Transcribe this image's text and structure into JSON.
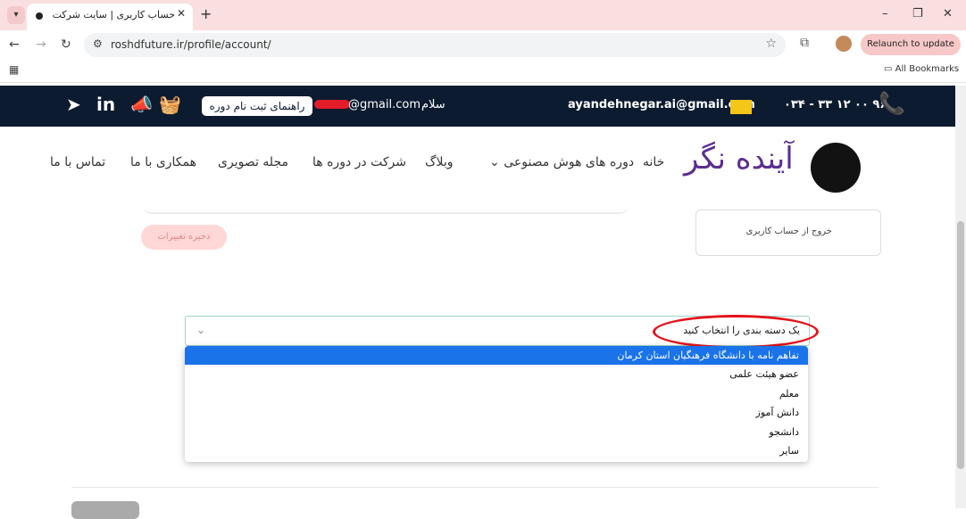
{
  "browser": {
    "tab_title": "حساب کاربری | سایت شرکت فناور",
    "url": "roshdfuture.ir/profile/account/",
    "relaunch_label": "Relaunch to update",
    "all_bookmarks": "All Bookmarks",
    "icons": {
      "tab_menu": "chevron-down-icon",
      "tab_close": "close-icon",
      "new_tab": "plus-icon",
      "minimize": "minimize-icon",
      "restore": "restore-icon",
      "window_close": "close-icon",
      "back": "arrow-left-icon",
      "forward": "arrow-right-icon",
      "reload": "reload-icon",
      "site_info": "tune-icon",
      "bookmark_star": "star-icon",
      "extensions": "puzzle-icon",
      "apps": "apps-grid-icon",
      "folder": "folder-icon"
    }
  },
  "site": {
    "topbar": {
      "phone": "۰۳۴ - ۳۳ ۱۲ ۰۰ ۹۶",
      "email": "ayandehnegar.ai@gmail.com",
      "greeting_prefix": "سلام",
      "user_email_suffix": "@gmail.com",
      "guide_button": "راهنمای ثبت نام دوره",
      "social_icons": [
        "telegram-icon",
        "linkedin-icon",
        "megaphone-icon",
        "basket-icon"
      ]
    },
    "brand": "آینده نگر",
    "nav": {
      "home": "خانه",
      "ai_courses": "دوره های هوش مصنوعی",
      "blog": "وبلاگ",
      "join_courses": "شرکت در دوره ها",
      "video_mag": "مجله تصویری",
      "cooperation": "همکاری با ما",
      "contact": "تماس با ما"
    },
    "colors": {
      "topbar": "#0d1b30",
      "brand": "#5a2e91",
      "accent_yellow": "#f5b40c",
      "selected_option": "#1a73e8",
      "annotation_red": "#e3141b"
    }
  },
  "account": {
    "save_button": "ذخیره تغییرات",
    "logout": "خروج از حساب کاربری",
    "category_select": {
      "placeholder": "یک دسته بندی را انتخاب کنید",
      "options": [
        "تفاهم نامه با دانشگاه فرهنگیان استان کرمان",
        "عضو هیئت علمی",
        "معلم",
        "دانش آموز",
        "دانشجو",
        "سایر"
      ],
      "highlighted_index": 0
    }
  }
}
